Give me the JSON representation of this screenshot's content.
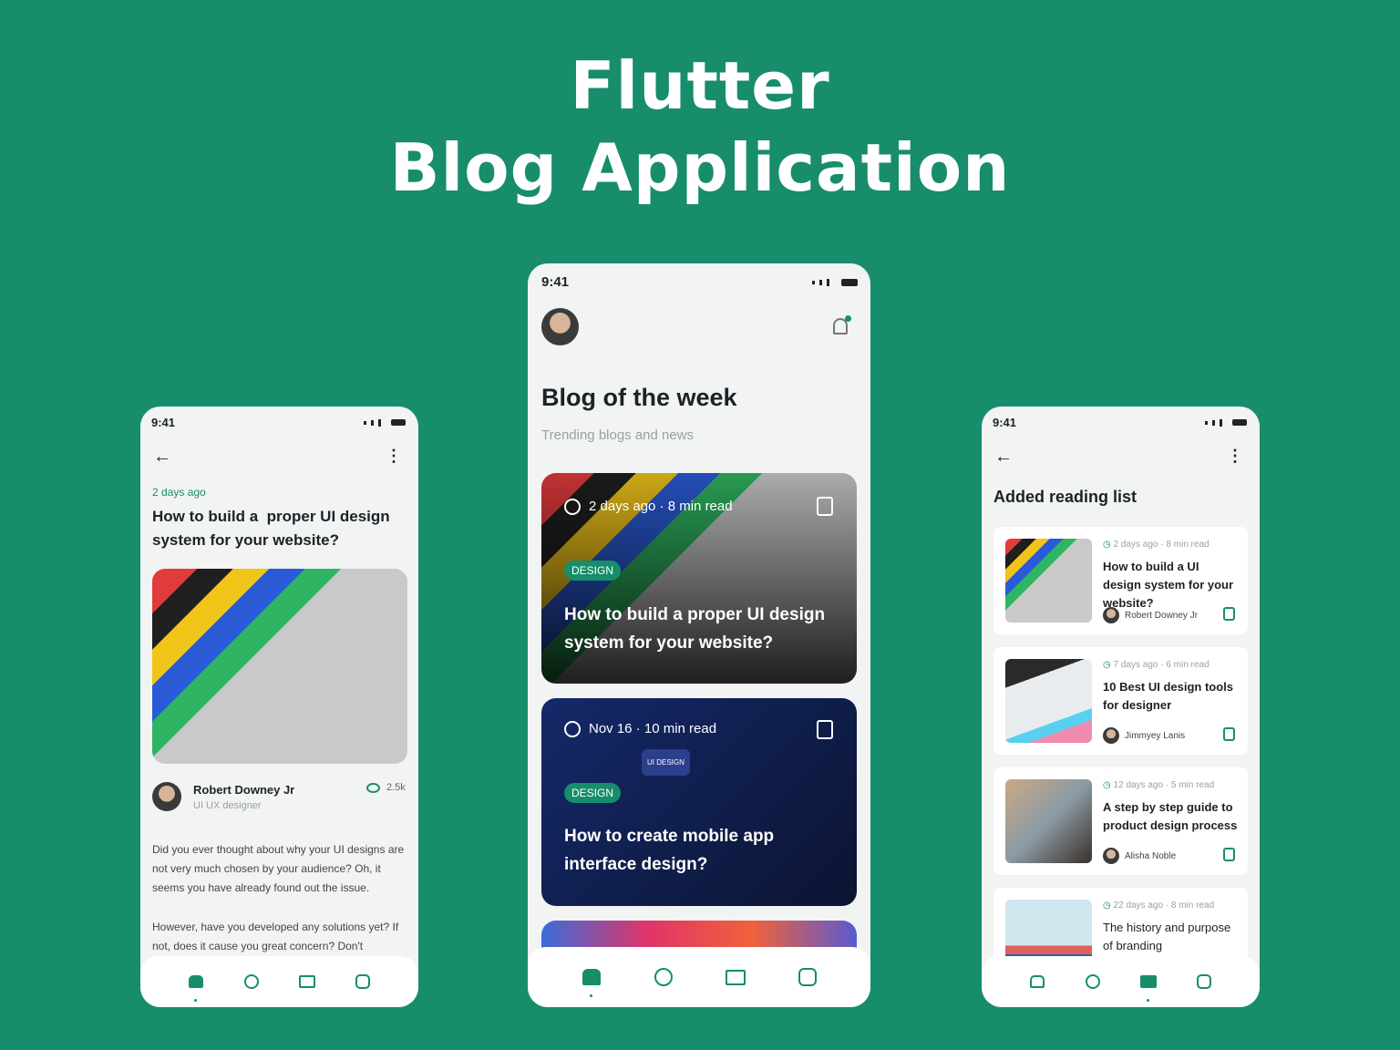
{
  "header": {
    "line1": "Flutter",
    "line2": "Blog Application"
  },
  "colors": {
    "background": "#178d6b",
    "accent": "#178d6b"
  },
  "status_time": "9:41",
  "left": {
    "date": "2 days ago",
    "title": "How to build a  proper UI design system for your website?",
    "author": "Robert Downey Jr",
    "role": "UI UX designer",
    "views": "2.5k",
    "p1": "Did you ever thought about why your UI designs are not very much chosen by your audience? Oh, it seems you have already found out the issue.",
    "p2": "However, have you developed any solutions yet? If not, does it cause you great concern? Don't",
    "active_tab": "home"
  },
  "center": {
    "title": "Blog of the week",
    "subtitle": "Trending blogs and news",
    "cards": [
      {
        "meta": "2 days ago · 8 min read",
        "tag": "DESIGN",
        "title": "How to build a proper UI design system for your website?"
      },
      {
        "meta": "Nov 16 · 10 min read",
        "tag": "DESIGN",
        "title": "How to create mobile app interface design?",
        "image_label": "UI DESIGN"
      }
    ],
    "active_tab": "home"
  },
  "right": {
    "title": "Added reading list",
    "items": [
      {
        "meta": "2 days ago · 8 min read",
        "title": "How to build a UI design system for your website?",
        "author": "Robert Downey Jr"
      },
      {
        "meta": "7 days ago · 6 min read",
        "title": "10 Best UI design tools for designer",
        "author": "Jimmyey Lanis"
      },
      {
        "meta": "12 days ago · 5 min read",
        "title": "A step by step guide to product design process",
        "author": "Alisha Noble"
      },
      {
        "meta": "22 days ago · 8 min read",
        "title": "The history and purpose of branding"
      }
    ],
    "active_tab": "reading-list"
  }
}
